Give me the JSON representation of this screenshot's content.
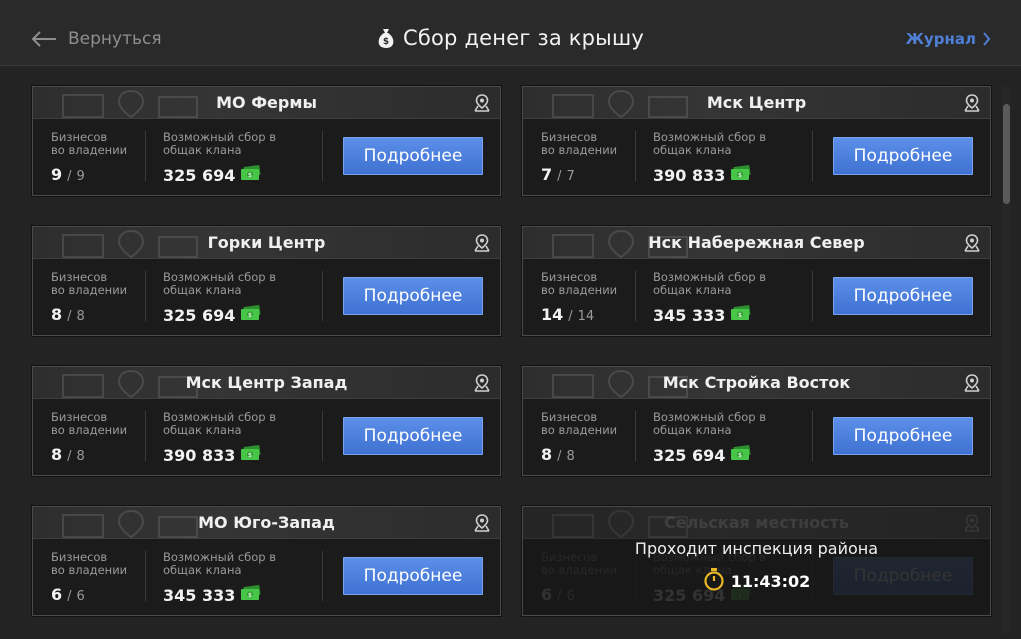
{
  "header": {
    "back_label": "Вернуться",
    "title": "Сбор денег за крышу",
    "journal_label": "Журнал"
  },
  "labels": {
    "owned_line1": "Бизнесов",
    "owned_line2": "во владении",
    "collect_line1": "Возможный сбор в",
    "collect_line2": "общак клана",
    "details_button": "Подробнее"
  },
  "cards": [
    {
      "name": "МО Фермы",
      "owned": "9",
      "total": "9",
      "amount": "325 694"
    },
    {
      "name": "Мск Центр",
      "owned": "7",
      "total": "7",
      "amount": "390 833"
    },
    {
      "name": "Горки Центр",
      "owned": "8",
      "total": "8",
      "amount": "325 694"
    },
    {
      "name": "Нск Набережная Север",
      "owned": "14",
      "total": "14",
      "amount": "345 333"
    },
    {
      "name": "Мск Центр Запад",
      "owned": "8",
      "total": "8",
      "amount": "390 833"
    },
    {
      "name": "Мск Стройка Восток",
      "owned": "8",
      "total": "8",
      "amount": "325 694"
    },
    {
      "name": "МО Юго-Запад",
      "owned": "6",
      "total": "6",
      "amount": "345 333"
    },
    {
      "name": "Сельская местность",
      "owned": "6",
      "total": "6",
      "amount": "325 694",
      "inspection_text": "Проходит инспекция района",
      "timer": "11:43:02"
    }
  ],
  "colors": {
    "accent": "#4f7fd6",
    "button": "#4a80e0",
    "money_icon": "#3fbf3f",
    "timer_icon": "#e8b824"
  },
  "icons": {
    "back": "arrow-left-icon",
    "title": "money-bag-icon",
    "journal": "chevron-right-icon",
    "card_pin": "map-pin-icon",
    "money": "cash-icon",
    "timer": "stopwatch-icon"
  }
}
